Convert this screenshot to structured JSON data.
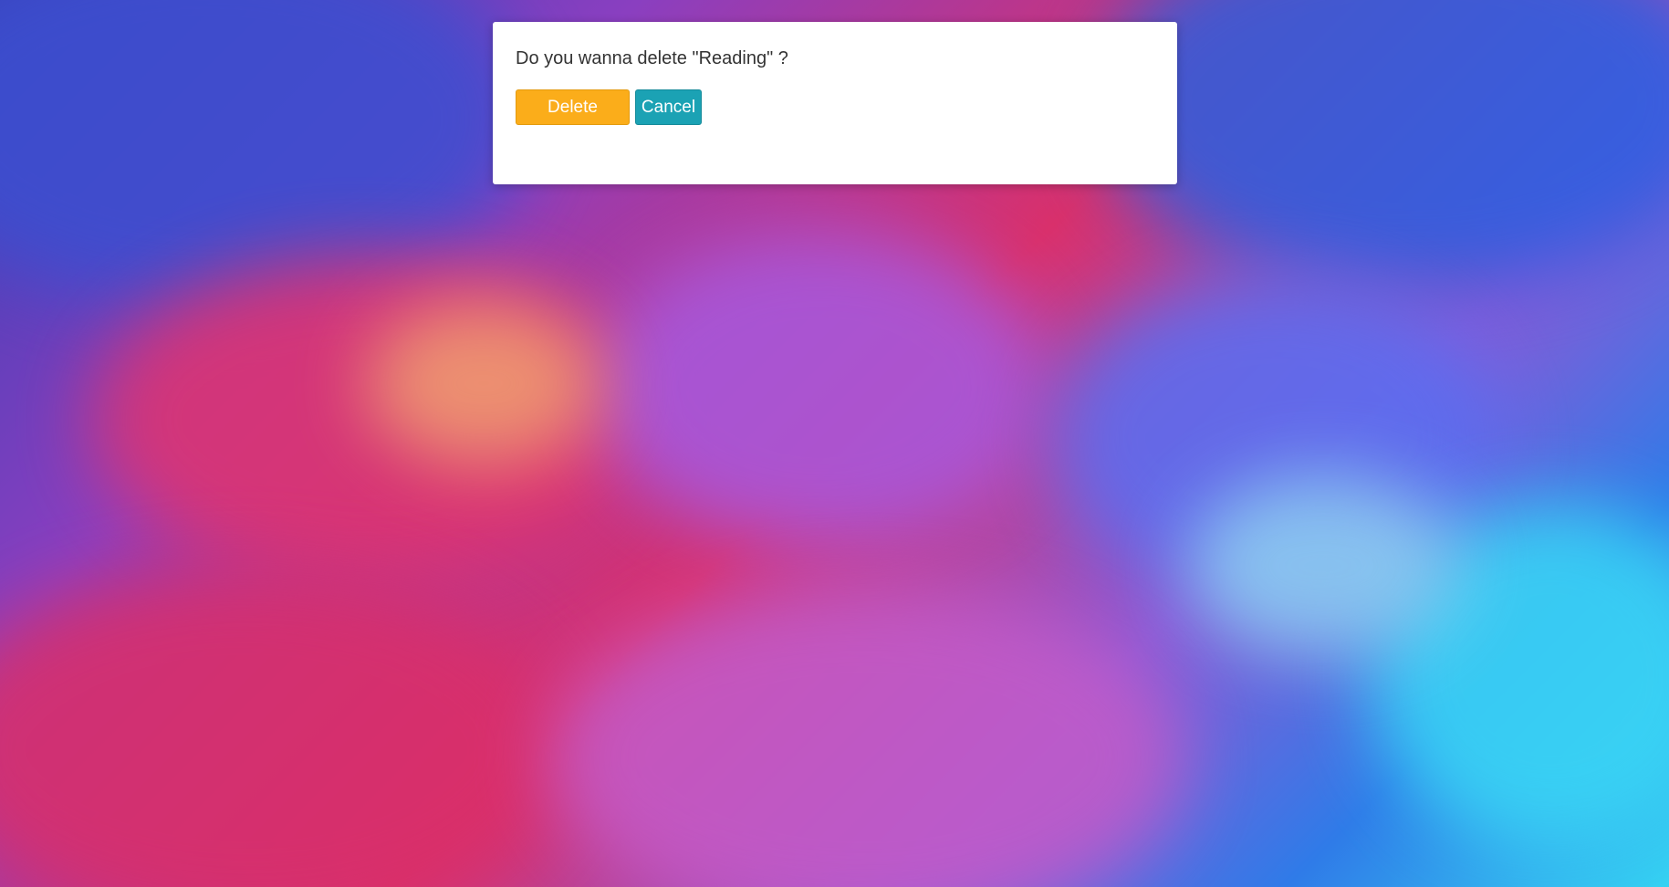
{
  "dialog": {
    "message": "Do you wanna delete \"Reading\" ?",
    "delete_label": "Delete",
    "cancel_label": "Cancel"
  },
  "colors": {
    "delete_button": "#fbad1a",
    "cancel_button": "#1ba2b4",
    "dialog_background": "#ffffff",
    "text": "#333333"
  }
}
